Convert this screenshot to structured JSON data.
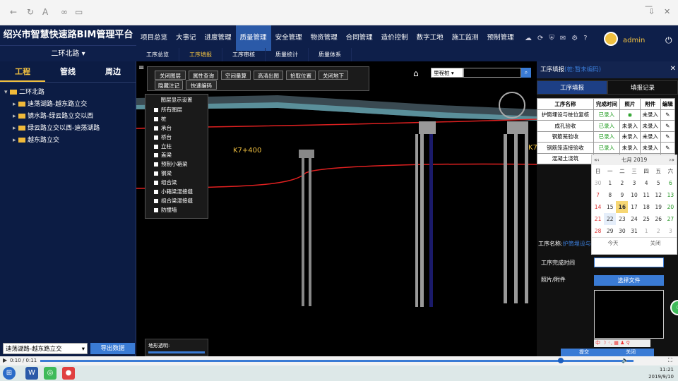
{
  "app": {
    "title": "绍兴市智慧快速路BIM管理平台",
    "line_select": "二环北路",
    "username": "admin"
  },
  "main_nav": [
    "项目总览",
    "大事记",
    "进度管理",
    "质量管理",
    "安全管理",
    "物资管理",
    "合同管理",
    "造价控制",
    "数字工地",
    "施工监测",
    "预制管理"
  ],
  "sub_nav": [
    "工序总览",
    "工序填报",
    "工序审核",
    "质量统计",
    "质量体系"
  ],
  "sidebar": {
    "tabs": [
      "工程",
      "管线",
      "周边"
    ],
    "tree_root": "二环北路",
    "tree_children": [
      "迪荡湖路-越东路立交",
      "镜水路-绿云路立交以西",
      "绿云路立交以西-迪荡湖路",
      "越东路立交"
    ],
    "segment_select": "迪荡湖路-越东路立交",
    "export_label": "导出数据"
  },
  "toolbar": [
    "关闭图层",
    "属性查询",
    "空间量算",
    "高清出图",
    "拾取位置",
    "关闭地下",
    "隐藏注记",
    "快速编码"
  ],
  "layer_panel": {
    "title": "图层显示设置",
    "items": [
      "所有图层",
      "桩",
      "承台",
      "桥台",
      "立柱",
      "盖梁",
      "预制小箱梁",
      "钢梁",
      "组合梁",
      "小箱梁湿接缝",
      "组合梁湿接缝",
      "防撞墙"
    ]
  },
  "search": {
    "select": "里程桩"
  },
  "scene_labels": [
    "K7+400",
    "K7"
  ],
  "opacity_label": "地形透明:",
  "right_panel": {
    "title": "工序填报",
    "subtitle": "(桩:暂未编码)",
    "tabs": [
      "工序填报",
      "填报记录"
    ],
    "table_headers": [
      "工序名称",
      "完成时间",
      "照片",
      "附件",
      "编辑"
    ],
    "rows": [
      {
        "name": "护筒埋设与桩位复核",
        "status": "已录入",
        "photo": "",
        "attach": "未录入"
      },
      {
        "name": "成孔验收",
        "status": "已录入",
        "photo": "未录入",
        "attach": "未录入"
      },
      {
        "name": "钢筋笼验收",
        "status": "已录入",
        "photo": "未录入",
        "attach": "未录入"
      },
      {
        "name": "钢筋笼连接验收",
        "status": "已录入",
        "photo": "未录入",
        "attach": "未录入"
      },
      {
        "name": "混凝土浇筑",
        "status": "已录入",
        "photo": "",
        "attach": ""
      }
    ],
    "form_name_label": "工序名称:",
    "form_name_value": "护筒埋设与桩位复核",
    "time_label": "工序完成时间",
    "photo_label": "照片/附件",
    "choose_file": "选择文件",
    "ok_label": "提交",
    "close_label": "关闭"
  },
  "calendar": {
    "month_label": "七月 2019",
    "weekdays": [
      "日",
      "一",
      "二",
      "三",
      "四",
      "五",
      "六"
    ],
    "days": [
      "30",
      "1",
      "2",
      "3",
      "4",
      "5",
      "6",
      "7",
      "8",
      "9",
      "10",
      "11",
      "12",
      "13",
      "14",
      "15",
      "16",
      "17",
      "18",
      "19",
      "20",
      "21",
      "22",
      "23",
      "24",
      "25",
      "26",
      "27",
      "28",
      "29",
      "30",
      "31",
      "1",
      "2",
      "3"
    ],
    "today_label": "今天",
    "close_label": "关闭"
  },
  "video": {
    "time": "0:10 / 0:11"
  },
  "clock": {
    "time": "11:21",
    "date": "2019/9/10"
  },
  "colors": {
    "header_bg": "#0e1f4a",
    "accent": "#f0c040",
    "active_nav": "#2b5aa8",
    "button_blue": "#3a7bd5"
  }
}
